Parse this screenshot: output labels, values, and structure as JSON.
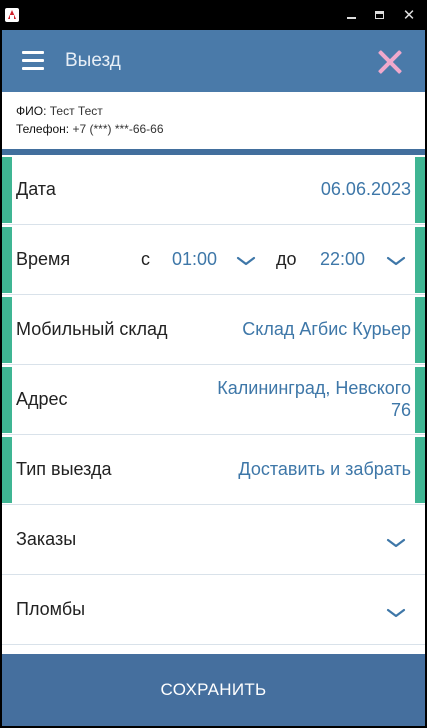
{
  "window": {
    "minimize_glyph": "",
    "close_glyph": "✕"
  },
  "header": {
    "title": "Выезд"
  },
  "client": {
    "fio_label": "ФИО:",
    "fio_value": "Тест Тест",
    "phone_label": "Телефон:",
    "phone_value": "+7 (***) ***-66-66"
  },
  "form": {
    "date": {
      "label": "Дата",
      "value": "06.06.2023"
    },
    "time": {
      "label": "Время",
      "from_prefix": "с",
      "from": "01:00",
      "to_prefix": "до",
      "to": "22:00"
    },
    "warehouse": {
      "label": "Мобильный склад",
      "value": "Склад Агбис Курьер"
    },
    "address": {
      "label": "Адрес",
      "line1": "Калининград, Невского",
      "line2": "76"
    },
    "trip_type": {
      "label": "Тип выезда",
      "value": "Доставить и забрать"
    },
    "orders": {
      "label": "Заказы"
    },
    "seals": {
      "label": "Пломбы"
    }
  },
  "footer": {
    "save_label": "СОХРАНИТЬ"
  },
  "colors": {
    "header_bg": "#4a7aa9",
    "accent_green": "#3fb593",
    "value_blue": "#3e77a8",
    "close_pink": "#f0a9cc",
    "save_bg": "#456f9e"
  }
}
